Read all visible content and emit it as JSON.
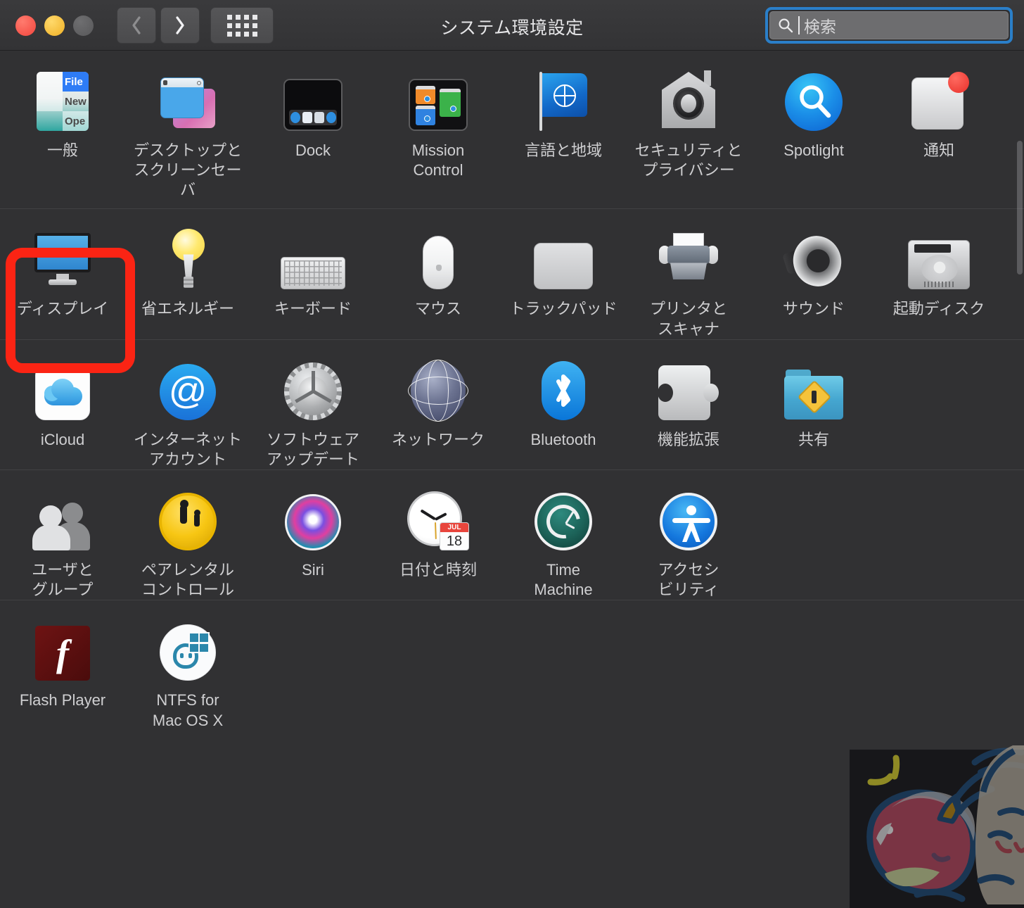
{
  "window": {
    "title": "システム環境設定",
    "traffic_lights": [
      "close",
      "minimize",
      "zoom"
    ],
    "back_label": "戻る",
    "forward_label": "進む",
    "grid_label": "すべてを表示",
    "accent_blue": "#2a7fc9",
    "background": "#313133",
    "highlight_color": "#fb2414"
  },
  "search": {
    "placeholder": "検索",
    "value": "",
    "focused": true
  },
  "rows": [
    {
      "id": "row-personal",
      "items": [
        {
          "name": "general",
          "icon": "general-icon",
          "label_lines": [
            "一般"
          ]
        },
        {
          "name": "desktop-screensaver",
          "icon": "desktop-screensaver-icon",
          "label_lines": [
            "デスクトップと",
            "スクリーンセーバ"
          ]
        },
        {
          "name": "dock",
          "icon": "dock-icon",
          "label_lines": [
            "Dock"
          ]
        },
        {
          "name": "mission-control",
          "icon": "mission-control-icon",
          "label_lines": [
            "Mission",
            "Control"
          ]
        },
        {
          "name": "language-region",
          "icon": "language-region-icon",
          "label_lines": [
            "言語と地域"
          ]
        },
        {
          "name": "security-privacy",
          "icon": "security-privacy-icon",
          "label_lines": [
            "セキュリティと",
            "プライバシー"
          ]
        },
        {
          "name": "spotlight",
          "icon": "spotlight-icon",
          "label_lines": [
            "Spotlight"
          ]
        },
        {
          "name": "notifications",
          "icon": "notifications-icon",
          "label_lines": [
            "通知"
          ],
          "badge": true
        }
      ]
    },
    {
      "id": "row-hardware",
      "items": [
        {
          "name": "displays",
          "icon": "displays-icon",
          "label_lines": [
            "ディスプレイ"
          ],
          "highlighted": true
        },
        {
          "name": "energy-saver",
          "icon": "energy-saver-icon",
          "label_lines": [
            "省エネルギー"
          ]
        },
        {
          "name": "keyboard",
          "icon": "keyboard-icon",
          "label_lines": [
            "キーボード"
          ]
        },
        {
          "name": "mouse",
          "icon": "mouse-icon",
          "label_lines": [
            "マウス"
          ]
        },
        {
          "name": "trackpad",
          "icon": "trackpad-icon",
          "label_lines": [
            "トラックパッド"
          ]
        },
        {
          "name": "printers-scanners",
          "icon": "printers-scanners-icon",
          "label_lines": [
            "プリンタと",
            "スキャナ"
          ]
        },
        {
          "name": "sound",
          "icon": "sound-icon",
          "label_lines": [
            "サウンド"
          ]
        },
        {
          "name": "startup-disk",
          "icon": "startup-disk-icon",
          "label_lines": [
            "起動ディスク"
          ]
        }
      ]
    },
    {
      "id": "row-internet",
      "items": [
        {
          "name": "icloud",
          "icon": "icloud-icon",
          "label_lines": [
            "iCloud"
          ]
        },
        {
          "name": "internet-accounts",
          "icon": "internet-accounts-icon",
          "label_lines": [
            "インターネット",
            "アカウント"
          ]
        },
        {
          "name": "software-update",
          "icon": "software-update-icon",
          "label_lines": [
            "ソフトウェア",
            "アップデート"
          ]
        },
        {
          "name": "network",
          "icon": "network-icon",
          "label_lines": [
            "ネットワーク"
          ]
        },
        {
          "name": "bluetooth",
          "icon": "bluetooth-icon",
          "label_lines": [
            "Bluetooth"
          ]
        },
        {
          "name": "extensions",
          "icon": "extensions-icon",
          "label_lines": [
            "機能拡張"
          ]
        },
        {
          "name": "sharing",
          "icon": "sharing-icon",
          "label_lines": [
            "共有"
          ]
        }
      ]
    },
    {
      "id": "row-system",
      "items": [
        {
          "name": "users-groups",
          "icon": "users-groups-icon",
          "label_lines": [
            "ユーザと",
            "グループ"
          ]
        },
        {
          "name": "parental-controls",
          "icon": "parental-controls-icon",
          "label_lines": [
            "ペアレンタル",
            "コントロール"
          ]
        },
        {
          "name": "siri",
          "icon": "siri-icon",
          "label_lines": [
            "Siri"
          ]
        },
        {
          "name": "date-time",
          "icon": "date-time-icon",
          "label_lines": [
            "日付と時刻"
          ],
          "clock": {
            "month": "JUL",
            "day": "18"
          }
        },
        {
          "name": "time-machine",
          "icon": "time-machine-icon",
          "label_lines": [
            "Time",
            "Machine"
          ]
        },
        {
          "name": "accessibility",
          "icon": "accessibility-icon",
          "label_lines": [
            "アクセシ",
            "ビリティ"
          ]
        }
      ]
    },
    {
      "id": "row-third-party",
      "items": [
        {
          "name": "flash-player",
          "icon": "flash-player-icon",
          "label_lines": [
            "Flash Player"
          ]
        },
        {
          "name": "ntfs-for-mac",
          "icon": "ntfs-for-mac-icon",
          "label_lines": [
            "NTFS for",
            "Mac OS X"
          ]
        }
      ]
    }
  ]
}
